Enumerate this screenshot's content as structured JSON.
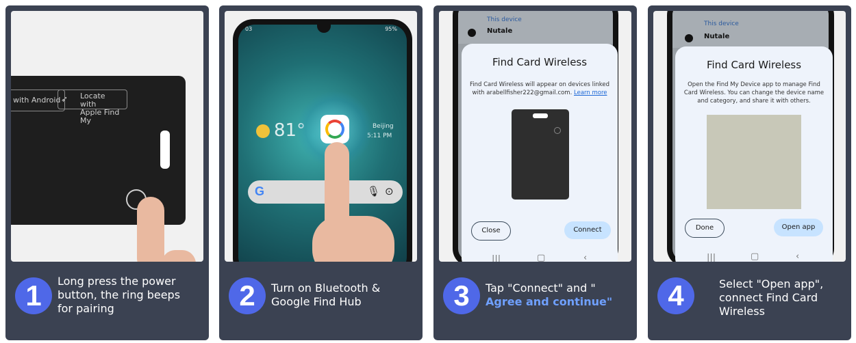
{
  "steps": [
    {
      "number": "1",
      "lines": [
        "Long press the power",
        "button, the ring beeps",
        "for pairing"
      ],
      "highlight": ""
    },
    {
      "number": "2",
      "lines": [
        "Turn on Bluetooth &",
        "Google Find Hub"
      ],
      "highlight": ""
    },
    {
      "number": "3",
      "lines": [
        "Tap \"Connect\" and \""
      ],
      "highlight": "Agree and continue\""
    },
    {
      "number": "4",
      "lines": [
        "Select \"Open app\",",
        "connect Find Card",
        "Wireless"
      ],
      "highlight": ""
    }
  ],
  "card_badges": {
    "android": "with Android",
    "apple_line1": "Locate with",
    "apple_line2": "Apple Find My"
  },
  "phone2": {
    "status_left": "03",
    "status_right": "95%",
    "temperature": "81°",
    "city": "Beijing",
    "time": "5:11 PM"
  },
  "dialog3": {
    "list_sub": "This device",
    "list_name": "Nutale",
    "title": "Find Card Wireless",
    "body_line1": "Find Card Wireless will appear on devices linked",
    "body_line2_prefix": "with arabellfisher222@gmail.com.",
    "learn_more": "Learn more",
    "close_label": "Close",
    "connect_label": "Connect"
  },
  "dialog4": {
    "list_sub": "This device",
    "list_name": "Nutale",
    "title": "Find Card Wireless",
    "body_line1": "Open the Find My Device app to manage Find",
    "body_line2": "Card Wireless. You can change the device name",
    "body_line3": "and category, and share it with others.",
    "done_label": "Done",
    "open_label": "Open app"
  },
  "colors": {
    "panel": "#3b4252",
    "accent": "#4f68e8",
    "highlight": "#6fa0ff",
    "button_fill": "#c7e3ff"
  }
}
